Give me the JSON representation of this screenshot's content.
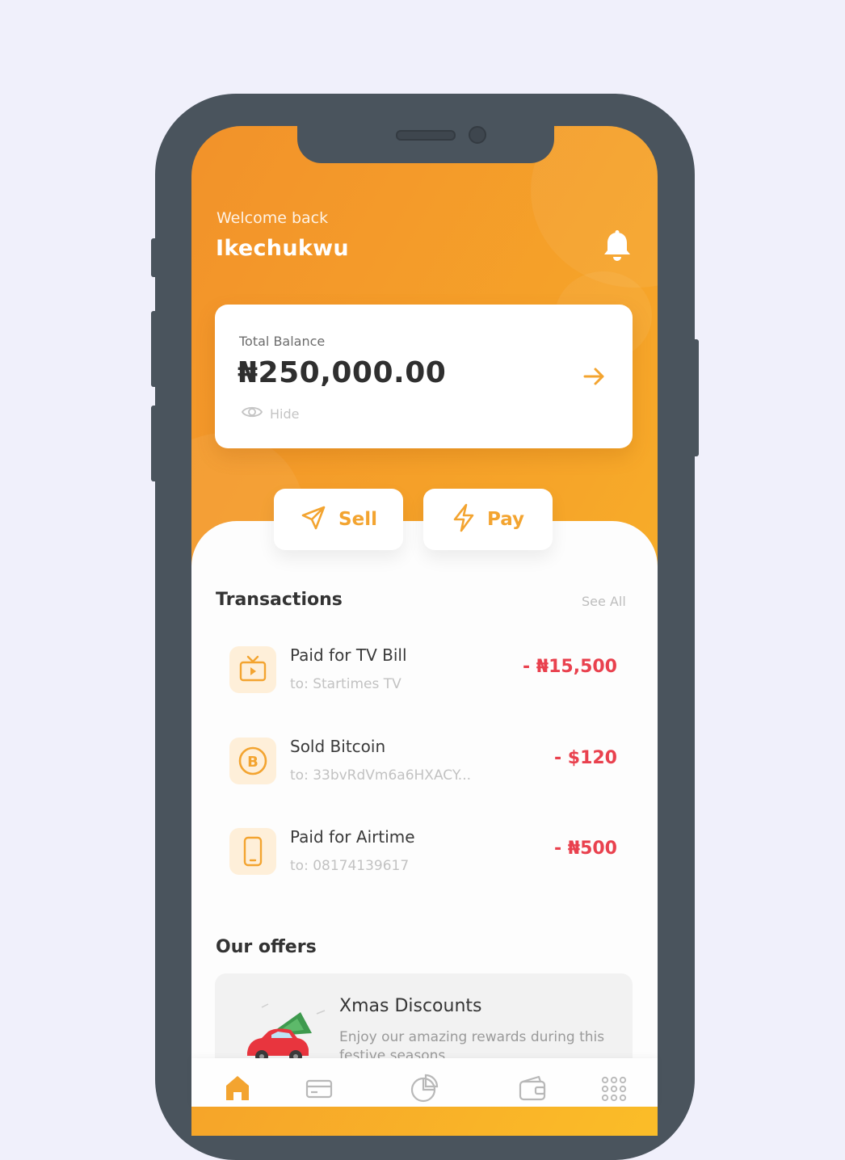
{
  "header": {
    "welcome": "Welcome back",
    "username": "Ikechukwu",
    "bell_icon": "bell-icon"
  },
  "balance": {
    "label": "Total Balance",
    "amount": "₦250,000.00",
    "hide_label": "Hide",
    "icons": [
      "arrow-right-icon",
      "eye-icon"
    ]
  },
  "actions": [
    {
      "label": "Sell",
      "icon": "send-icon"
    },
    {
      "label": "Pay",
      "icon": "lightning-icon"
    }
  ],
  "transactions": {
    "title": "Transactions",
    "see_all": "See All",
    "items": [
      {
        "title": "Paid for TV Bill",
        "sub": "to: Startimes TV",
        "amount": "- ₦15,500",
        "icon": "tv-icon"
      },
      {
        "title": "Sold Bitcoin",
        "sub": "to: 33bvRdVm6a6HXACY...",
        "amount": "- $120",
        "icon": "bitcoin-icon"
      },
      {
        "title": "Paid for Airtime",
        "sub": "to: 08174139617",
        "amount": "- ₦500",
        "icon": "phone-icon"
      }
    ]
  },
  "offers": {
    "title": "Our offers",
    "items": [
      {
        "title": "Xmas Discounts",
        "desc": "Enjoy our amazing rewards during this festive seasons"
      }
    ]
  },
  "nav": {
    "items": [
      "home-icon",
      "card-icon",
      "pie-chart-icon",
      "wallet-icon",
      "grid-icon"
    ],
    "active": "home-icon"
  },
  "colors": {
    "accent": "#F3A430",
    "negative": "#E9414E",
    "background": "#F0F0FB",
    "phone_frame": "#4A545D"
  }
}
